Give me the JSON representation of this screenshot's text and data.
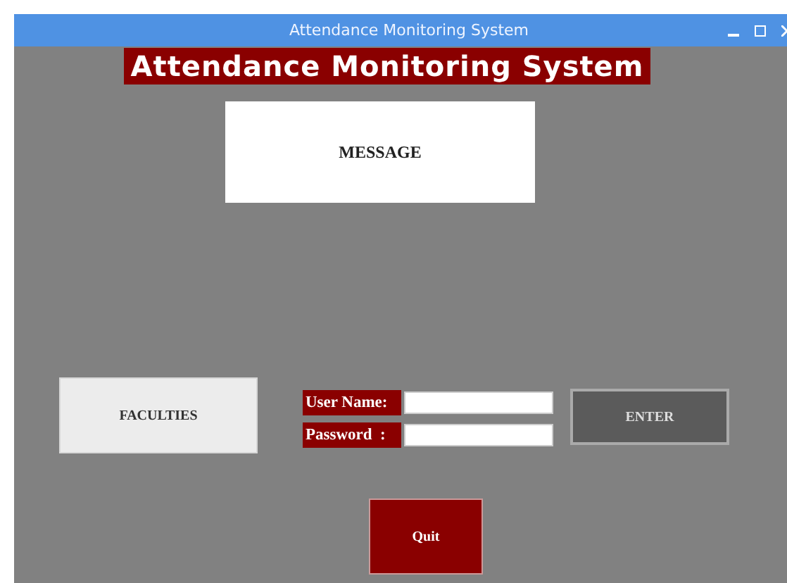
{
  "window": {
    "title": "Attendance Monitoring System"
  },
  "heading": "Attendance Monitoring System",
  "message": "MESSAGE",
  "faculties_button": "FACULTIES",
  "login_fields": [
    {
      "label": "User Name:"
    },
    {
      "label": "Password  :"
    }
  ],
  "enter_button": "ENTER",
  "quit_button": "Quit"
}
